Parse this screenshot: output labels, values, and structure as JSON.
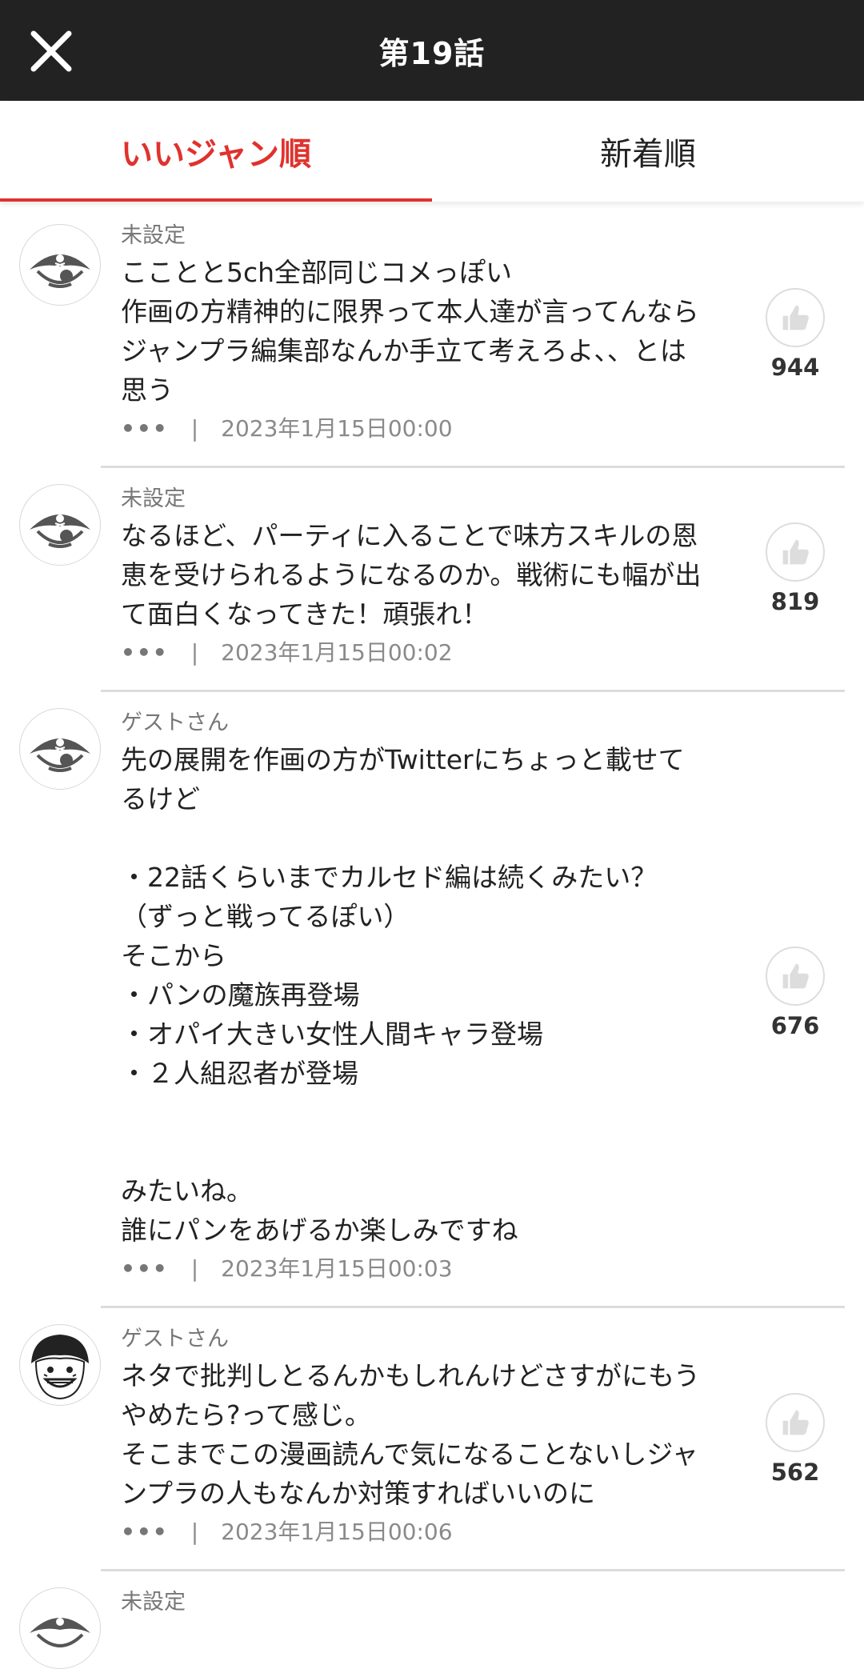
{
  "header": {
    "title": "第19話",
    "close_icon": "close-icon"
  },
  "tabs": [
    {
      "label": "いいジャン順",
      "active": true
    },
    {
      "label": "新着順",
      "active": false
    }
  ],
  "colors": {
    "accent": "#e0322e",
    "header_bg": "#222222"
  },
  "comments": [
    {
      "user": "未設定",
      "avatar": "pirate-avatar-icon",
      "text": "こことと5ch全部同じコメっぽい\n作画の方精神的に限界って本人達が言ってんなら\nジャンプラ編集部なんか手立て考えろよ、、とは\n思う",
      "meta_dots": "•••",
      "meta_sep": "|",
      "timestamp": "2023年1月15日00:00",
      "likes": "944"
    },
    {
      "user": "未設定",
      "avatar": "pirate-avatar-icon",
      "text": "なるほど、パーティに入ることで味方スキルの恩\n恵を受けられるようになるのか。戦術にも幅が出\nて面白くなってきた！頑張れ！",
      "meta_dots": "•••",
      "meta_sep": "|",
      "timestamp": "2023年1月15日00:02",
      "likes": "819"
    },
    {
      "user": "ゲストさん",
      "avatar": "pirate-avatar-icon",
      "text": "先の展開を作画の方がTwitterにちょっと載せて\nるけど\n\n・22話くらいまでカルセド編は続くみたい？\n（ずっと戦ってるぽい）\nそこから\n・パンの魔族再登場\n・オパイ大きい女性人間キャラ登場\n・２人組忍者が登場\n\n\nみたいね。\n誰にパンをあげるか楽しみですね",
      "meta_dots": "•••",
      "meta_sep": "|",
      "timestamp": "2023年1月15日00:03",
      "likes": "676"
    },
    {
      "user": "ゲストさん",
      "avatar": "character-avatar-icon",
      "text": "ネタで批判しとるんかもしれんけどさすがにもう\nやめたら?って感じ。\nそこまでこの漫画読んで気になることないしジャ\nンプラの人もなんか対策すればいいのに",
      "meta_dots": "•••",
      "meta_sep": "|",
      "timestamp": "2023年1月15日00:06",
      "likes": "562"
    },
    {
      "user": "未設定",
      "avatar": "pirate-avatar-icon",
      "text": "",
      "meta_dots": "",
      "meta_sep": "",
      "timestamp": "",
      "likes": ""
    }
  ]
}
